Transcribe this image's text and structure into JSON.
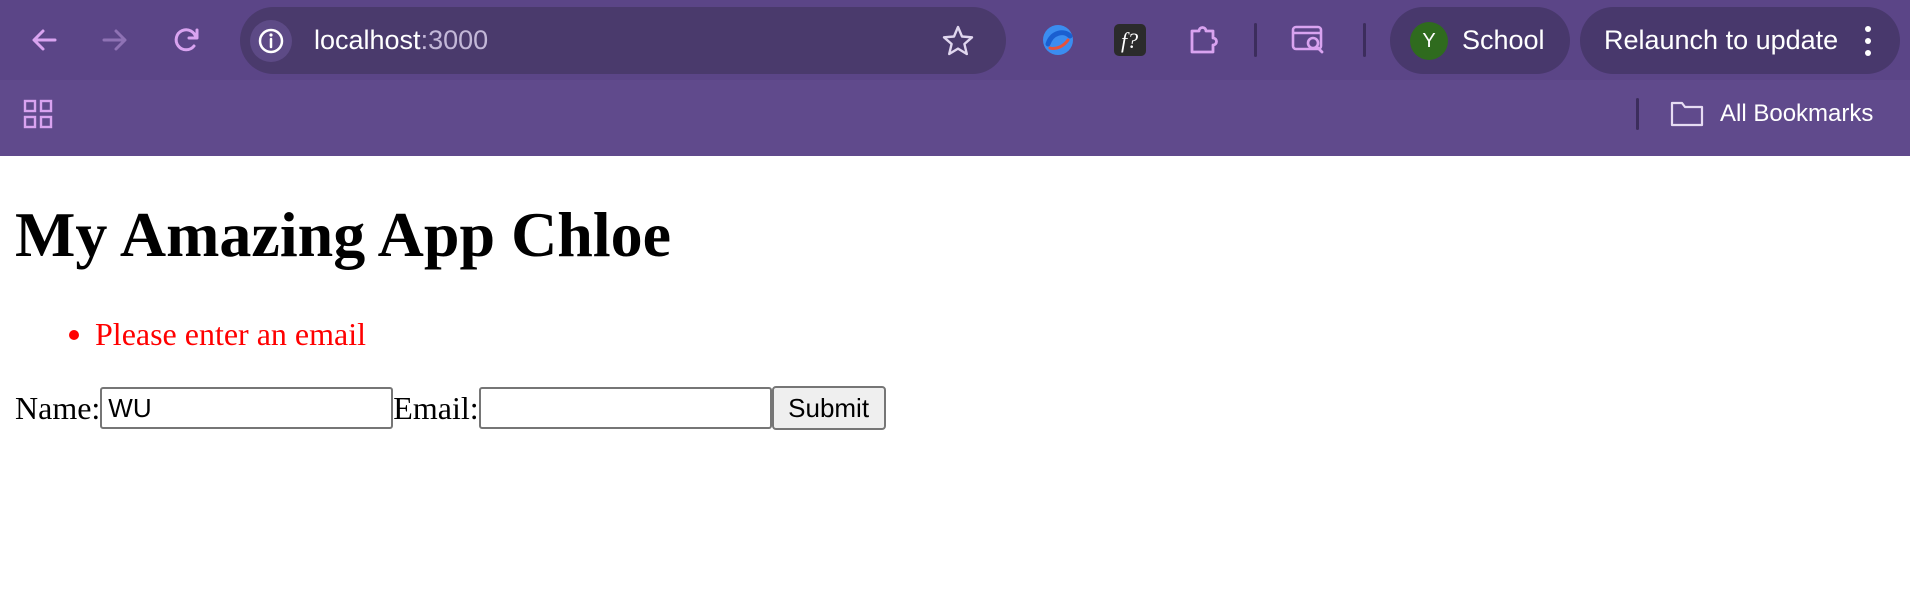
{
  "browser": {
    "url_host": "localhost",
    "url_port": ":3000",
    "profile_initial": "Y",
    "profile_name": "School",
    "relaunch_label": "Relaunch to update",
    "bookmarks_label": "All Bookmarks",
    "colors": {
      "chrome": "#5b4587",
      "omnibox": "#4a3a6c",
      "icon_accent": "#d9a3f0"
    },
    "icons": [
      "back-icon",
      "forward-icon",
      "reload-icon",
      "site-info-icon",
      "star-icon",
      "extension-swirl-icon",
      "extension-formula-icon",
      "extensions-puzzle-icon",
      "tab-search-icon",
      "apps-grid-icon",
      "folder-icon",
      "kebab-menu-icon"
    ]
  },
  "page": {
    "title": "My Amazing App Chloe",
    "errors": [
      "Please enter an email"
    ],
    "form": {
      "name_label": "Name:",
      "name_value": "WU",
      "email_label": "Email:",
      "email_value": "",
      "submit_label": "Submit"
    },
    "colors": {
      "error": "#ff0000"
    }
  }
}
